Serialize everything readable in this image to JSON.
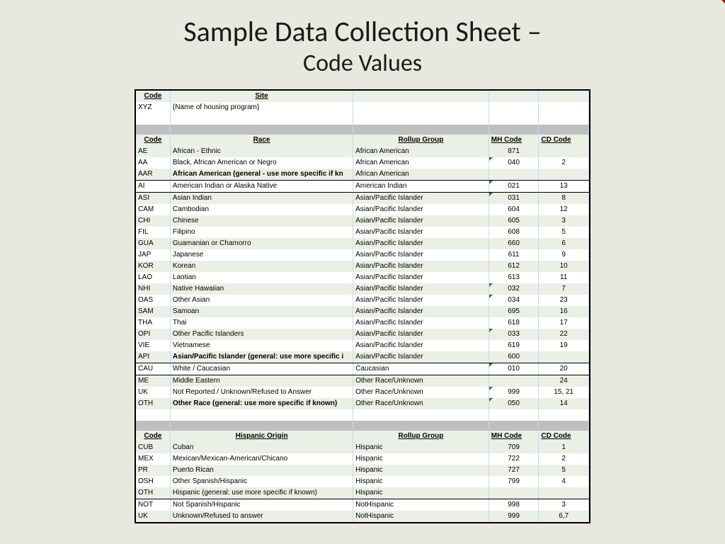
{
  "title_main": "Sample Data Collection Sheet –",
  "title_sub": "Code Values",
  "headers": {
    "code": "Code",
    "site": "Site",
    "race": "Race",
    "rollup": "Rollup Group",
    "mh": "MH Code",
    "cd": "CD Code",
    "hispanic": "Hispanic Origin"
  },
  "site_section": {
    "code": "XYZ",
    "name": "{Name of housing program}"
  },
  "race_rows": [
    {
      "code": "AE",
      "desc": "African - Ethnic",
      "roll": "African American",
      "mh": "871",
      "cd": "",
      "band": true,
      "mark": false
    },
    {
      "code": "AA",
      "desc": "Black, African American or Negro",
      "roll": "African American",
      "mh": "040",
      "cd": "2",
      "band": false,
      "mark": true
    },
    {
      "code": "AAR",
      "desc": "African American (general - use more specific if kn",
      "roll": "African American",
      "mh": "",
      "cd": "",
      "band": true,
      "bold": true,
      "thickBottom": true
    },
    {
      "code": "AI",
      "desc": "American Indian or Alaska Native",
      "roll": "American Indian",
      "mh": "021",
      "cd": "13",
      "band": false,
      "mark": true,
      "thickBottom": true
    },
    {
      "code": "ASI",
      "desc": "Asian Indian",
      "roll": "Asian/Pacific Islander",
      "mh": "031",
      "cd": "8",
      "band": true,
      "mark": true
    },
    {
      "code": "CAM",
      "desc": "Cambodian",
      "roll": "Asian/Pacific Islander",
      "mh": "604",
      "cd": "12",
      "band": false
    },
    {
      "code": "CHI",
      "desc": "Chinese",
      "roll": "Asian/Pacific Islander",
      "mh": "605",
      "cd": "3",
      "band": true
    },
    {
      "code": "FIL",
      "desc": "Filipino",
      "roll": "Asian/Pacific Islander",
      "mh": "608",
      "cd": "5",
      "band": false
    },
    {
      "code": "GUA",
      "desc": "Guamanian or Chamorro",
      "roll": "Asian/Pacific Islander",
      "mh": "660",
      "cd": "6",
      "band": true
    },
    {
      "code": "JAP",
      "desc": "Japanese",
      "roll": "Asian/Pacific Islander",
      "mh": "611",
      "cd": "9",
      "band": false
    },
    {
      "code": "KOR",
      "desc": "Korean",
      "roll": "Asian/Pacific Islander",
      "mh": "612",
      "cd": "10",
      "band": true
    },
    {
      "code": "LAO",
      "desc": "Laotian",
      "roll": "Asian/Pacific Islander",
      "mh": "613",
      "cd": "11",
      "band": false
    },
    {
      "code": "NHI",
      "desc": "Native Hawaiian",
      "roll": "Asian/Pacific Islander",
      "mh": "032",
      "cd": "7",
      "band": true,
      "mark": true
    },
    {
      "code": "OAS",
      "desc": "Other Asian",
      "roll": "Asian/Pacific Islander",
      "mh": "034",
      "cd": "23",
      "band": false,
      "mark": true
    },
    {
      "code": "SAM",
      "desc": "Samoan",
      "roll": "Asian/Pacific Islander",
      "mh": "695",
      "cd": "16",
      "band": true
    },
    {
      "code": "THA",
      "desc": "Thai",
      "roll": "Asian/Pacific Islander",
      "mh": "618",
      "cd": "17",
      "band": false
    },
    {
      "code": "OPI",
      "desc": "Other Pacific Islanders",
      "roll": "Asian/Pacific Islander",
      "mh": "033",
      "cd": "22",
      "band": true,
      "mark": true
    },
    {
      "code": "VIE",
      "desc": "Vietnamese",
      "roll": "Asian/Pacific Islander",
      "mh": "619",
      "cd": "19",
      "band": false
    },
    {
      "code": "API",
      "desc": "Asian/Pacific Islander (general: use more specific i",
      "roll": "Asian/Pacific Islander",
      "mh": "600",
      "cd": "",
      "band": true,
      "bold": true,
      "thickBottom": true,
      "markRed": true
    },
    {
      "code": "CAU",
      "desc": "White / Caucasian",
      "roll": "Caucasian",
      "mh": "010",
      "cd": "20",
      "band": false,
      "mark": true,
      "thickBottom": true
    },
    {
      "code": "ME",
      "desc": "Middle Eastern",
      "roll": "Other Race/Unknown",
      "mh": "",
      "cd": "24",
      "band": true
    },
    {
      "code": "UK",
      "desc": "Not Reported / Unknown/Refused to Answer",
      "roll": "Other Race/Unknown",
      "mh": "999",
      "cd": "15, 21",
      "band": false,
      "mark": true
    },
    {
      "code": "OTH",
      "desc": "Other Race (general: use more specific if known)",
      "roll": "Other Race/Unknown",
      "mh": "050",
      "cd": "14",
      "band": true,
      "bold": true,
      "mark": true
    }
  ],
  "hispanic_rows": [
    {
      "code": "CUB",
      "desc": "Cuban",
      "roll": "Hispanic",
      "mh": "709",
      "cd": "1",
      "band": true
    },
    {
      "code": "MEX",
      "desc": "Mexican/Mexican-American/Chicano",
      "roll": "Hispanic",
      "mh": "722",
      "cd": "2",
      "band": false
    },
    {
      "code": "PR",
      "desc": "Puerto Rican",
      "roll": "Hispanic",
      "mh": "727",
      "cd": "5",
      "band": true
    },
    {
      "code": "OSH",
      "desc": "Other Spanish/Hispanic",
      "roll": "Hispanic",
      "mh": "799",
      "cd": "4",
      "band": false
    },
    {
      "code": "OTH",
      "desc": "Hispanic (general:  use more specific if known)",
      "roll": "Hispanic",
      "mh": "",
      "cd": "",
      "band": true,
      "thinBottom": true
    },
    {
      "code": "NOT",
      "desc": "Not Spanish/Hispanic",
      "roll": "NotHispanic",
      "mh": "998",
      "cd": "3",
      "band": false
    },
    {
      "code": "UK",
      "desc": "Unknown/Refused to answer",
      "roll": "NotHispanic",
      "mh": "999",
      "cd": "6,7",
      "band": true
    }
  ]
}
